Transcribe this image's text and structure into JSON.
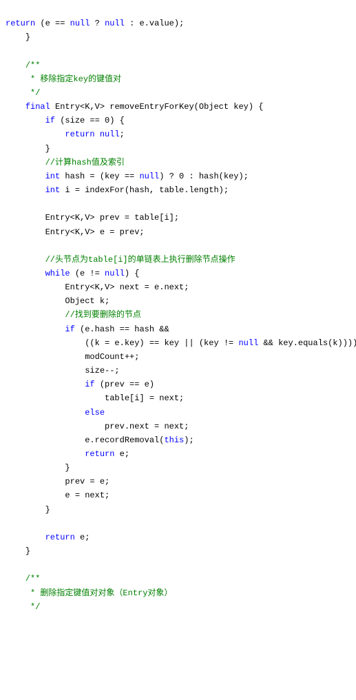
{
  "indent_unit": "    ",
  "lines": [
    {
      "indent": 0,
      "segments": [
        {
          "t": "return",
          "c": "kw"
        },
        {
          "t": " (e == "
        },
        {
          "t": "null",
          "c": "kw"
        },
        {
          "t": " ? "
        },
        {
          "t": "null",
          "c": "kw"
        },
        {
          "t": " : e.value);"
        }
      ]
    },
    {
      "indent": 1,
      "segments": [
        {
          "t": "}"
        }
      ]
    },
    {
      "indent": 0,
      "segments": [
        {
          "t": " "
        }
      ]
    },
    {
      "indent": 1,
      "segments": [
        {
          "t": "/**",
          "c": "cm"
        }
      ]
    },
    {
      "indent": 1,
      "segments": [
        {
          "t": " * 移除指定key的键值对",
          "c": "cm"
        }
      ]
    },
    {
      "indent": 1,
      "segments": [
        {
          "t": " */",
          "c": "cm"
        }
      ]
    },
    {
      "indent": 1,
      "segments": [
        {
          "t": "final",
          "c": "kw"
        },
        {
          "t": " Entry<K,V> removeEntryForKey(Object key) {"
        }
      ]
    },
    {
      "indent": 2,
      "segments": [
        {
          "t": "if",
          "c": "kw"
        },
        {
          "t": " (size == 0) {"
        }
      ]
    },
    {
      "indent": 3,
      "segments": [
        {
          "t": "return",
          "c": "kw"
        },
        {
          "t": " "
        },
        {
          "t": "null",
          "c": "kw"
        },
        {
          "t": ";"
        }
      ]
    },
    {
      "indent": 2,
      "segments": [
        {
          "t": "}"
        }
      ]
    },
    {
      "indent": 2,
      "segments": [
        {
          "t": "//计算hash值及索引",
          "c": "cm"
        }
      ]
    },
    {
      "indent": 2,
      "segments": [
        {
          "t": "int",
          "c": "kw"
        },
        {
          "t": " hash = (key == "
        },
        {
          "t": "null",
          "c": "kw"
        },
        {
          "t": ") ? 0 : hash(key);"
        }
      ]
    },
    {
      "indent": 2,
      "segments": [
        {
          "t": "int",
          "c": "kw"
        },
        {
          "t": " i = indexFor(hash, table.length);"
        }
      ]
    },
    {
      "indent": 0,
      "segments": [
        {
          "t": " "
        }
      ]
    },
    {
      "indent": 2,
      "segments": [
        {
          "t": "Entry<K,V> prev = table[i];"
        }
      ]
    },
    {
      "indent": 2,
      "segments": [
        {
          "t": "Entry<K,V> e = prev;"
        }
      ]
    },
    {
      "indent": 0,
      "segments": [
        {
          "t": " "
        }
      ]
    },
    {
      "indent": 2,
      "segments": [
        {
          "t": "//头节点为table[i]的单链表上执行删除节点操作",
          "c": "cm"
        }
      ]
    },
    {
      "indent": 2,
      "segments": [
        {
          "t": "while",
          "c": "kw"
        },
        {
          "t": " (e != "
        },
        {
          "t": "null",
          "c": "kw"
        },
        {
          "t": ") {"
        }
      ]
    },
    {
      "indent": 3,
      "segments": [
        {
          "t": "Entry<K,V> next = e.next;"
        }
      ]
    },
    {
      "indent": 3,
      "segments": [
        {
          "t": "Object k;"
        }
      ]
    },
    {
      "indent": 3,
      "segments": [
        {
          "t": "//找到要删除的节点",
          "c": "cm"
        }
      ]
    },
    {
      "indent": 3,
      "segments": [
        {
          "t": "if",
          "c": "kw"
        },
        {
          "t": " (e.hash == hash &&"
        }
      ]
    },
    {
      "indent": 4,
      "segments": [
        {
          "t": "((k = e.key) == key || (key != "
        },
        {
          "t": "null",
          "c": "kw"
        },
        {
          "t": " && key.equals(k)))) {"
        }
      ]
    },
    {
      "indent": 4,
      "segments": [
        {
          "t": "modCount++;"
        }
      ]
    },
    {
      "indent": 4,
      "segments": [
        {
          "t": "size--;"
        }
      ]
    },
    {
      "indent": 4,
      "segments": [
        {
          "t": "if",
          "c": "kw"
        },
        {
          "t": " (prev == e)"
        }
      ]
    },
    {
      "indent": 5,
      "segments": [
        {
          "t": "table[i] = next;"
        }
      ]
    },
    {
      "indent": 4,
      "segments": [
        {
          "t": "else",
          "c": "kw"
        }
      ]
    },
    {
      "indent": 5,
      "segments": [
        {
          "t": "prev.next = next;"
        }
      ]
    },
    {
      "indent": 4,
      "segments": [
        {
          "t": "e.recordRemoval("
        },
        {
          "t": "this",
          "c": "kw"
        },
        {
          "t": ");"
        }
      ]
    },
    {
      "indent": 4,
      "segments": [
        {
          "t": "return",
          "c": "kw"
        },
        {
          "t": " e;"
        }
      ]
    },
    {
      "indent": 3,
      "segments": [
        {
          "t": "}"
        }
      ]
    },
    {
      "indent": 3,
      "segments": [
        {
          "t": "prev = e;"
        }
      ]
    },
    {
      "indent": 3,
      "segments": [
        {
          "t": "e = next;"
        }
      ]
    },
    {
      "indent": 2,
      "segments": [
        {
          "t": "}"
        }
      ]
    },
    {
      "indent": 0,
      "segments": [
        {
          "t": " "
        }
      ]
    },
    {
      "indent": 2,
      "segments": [
        {
          "t": "return",
          "c": "kw"
        },
        {
          "t": " e;"
        }
      ]
    },
    {
      "indent": 1,
      "segments": [
        {
          "t": "}"
        }
      ]
    },
    {
      "indent": 0,
      "segments": [
        {
          "t": " "
        }
      ]
    },
    {
      "indent": 1,
      "segments": [
        {
          "t": "/**",
          "c": "cm"
        }
      ]
    },
    {
      "indent": 1,
      "segments": [
        {
          "t": " * 删除指定键值对对象（Entry对象）",
          "c": "cm"
        }
      ]
    },
    {
      "indent": 1,
      "segments": [
        {
          "t": " */",
          "c": "cm"
        }
      ]
    }
  ]
}
